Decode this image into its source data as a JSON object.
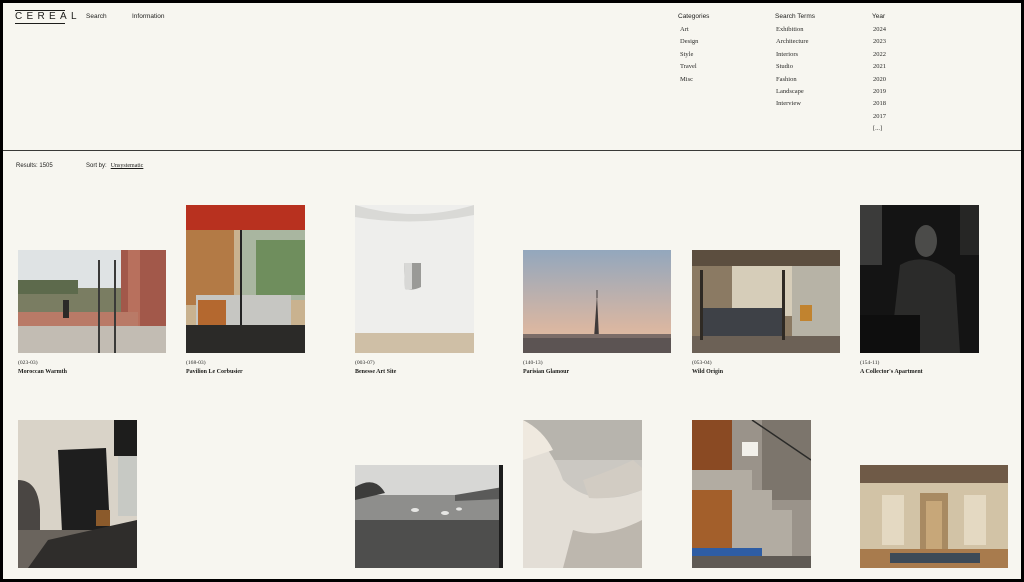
{
  "brand": {
    "logo": "CEREAL"
  },
  "topnav": {
    "search": "Search",
    "information": "Information"
  },
  "filters": {
    "categories": {
      "label": "Categories",
      "items": [
        "Art",
        "Design",
        "Style",
        "Travel",
        "Misc"
      ]
    },
    "search_terms": {
      "label": "Search Terms",
      "items": [
        "Exhibition",
        "Architecture",
        "Interiors",
        "Studio",
        "Fashion",
        "Landscape",
        "Interview"
      ]
    },
    "year": {
      "label": "Year",
      "items": [
        "2024",
        "2023",
        "2022",
        "2021",
        "2020",
        "2019",
        "2018",
        "2017",
        "[...]"
      ]
    }
  },
  "results": {
    "label": "Results:",
    "count": "1505"
  },
  "sort": {
    "label": "Sort by:",
    "value": "Unsystematic"
  },
  "articles": [
    {
      "code": "(023-03)",
      "title": "Moroccan Warmth",
      "image": "courtyard-photo"
    },
    {
      "code": "(168-03)",
      "title": "Pavilion Le Corbusier",
      "image": "kitchen-interior-photo"
    },
    {
      "code": "(003-07)",
      "title": "Benesse Art Site",
      "image": "white-gallery-photo"
    },
    {
      "code": "(140-13)",
      "title": "Parisian Glamour",
      "image": "eiffel-tower-photo"
    },
    {
      "code": "(053-04)",
      "title": "Wild Origin",
      "image": "bedroom-photo"
    },
    {
      "code": "(154-11)",
      "title": "A Collector's Apartment",
      "image": "portrait-photo"
    },
    {
      "code": "",
      "title": "",
      "image": "studio-photo"
    },
    {
      "code": "",
      "title": "",
      "image": "field-landscape-photo"
    },
    {
      "code": "",
      "title": "",
      "image": "horse-photo"
    },
    {
      "code": "",
      "title": "",
      "image": "concrete-stairs-photo"
    },
    {
      "code": "",
      "title": "",
      "image": "palazzo-interior-photo"
    }
  ]
}
